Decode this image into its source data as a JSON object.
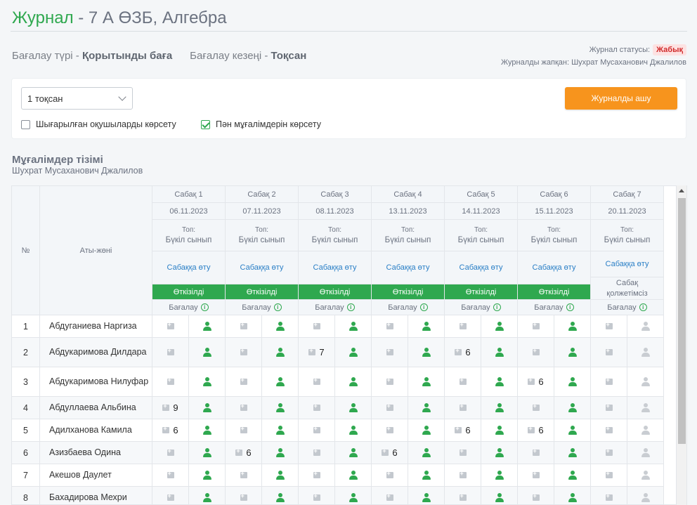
{
  "header": {
    "title_accent": "Журнал",
    "title_rest": " - 7 А ӨЗБ, Алгебра"
  },
  "assessment": {
    "type_label": "Бағалау түрі - ",
    "type_value": "Қорытынды баға",
    "period_label": "Бағалау кезеңі - ",
    "period_value": "Тоқсан"
  },
  "status": {
    "label": "Журнал статусы:",
    "value": "Жабық",
    "closed_by": "Журналды жапқан: Шухрат Мусаханович Джалилов"
  },
  "filters": {
    "period_select": "1 тоқсан",
    "open_button": "Журналды ашу",
    "show_graduated": {
      "label": "Шығарылған оқушыларды көрсету",
      "checked": false
    },
    "show_teachers": {
      "label": "Пән мұғалімдерін көрсету",
      "checked": true
    }
  },
  "teachers": {
    "title": "Мұғалімдер тізімі",
    "name": "Шухрат Мусаханович Джалилов"
  },
  "grid": {
    "col_num": "№",
    "col_name": "Аты-жөні",
    "type_label": "Топ:",
    "grade_label": "Бағалау",
    "lessons": [
      {
        "name": "Сабақ 1",
        "date": "06.11.2023",
        "group": "Бүкіл сынып",
        "link": "Сабаққа өту",
        "status": "Өткізілді",
        "done": true
      },
      {
        "name": "Сабақ 2",
        "date": "07.11.2023",
        "group": "Бүкіл сынып",
        "link": "Сабаққа өту",
        "status": "Өткізілді",
        "done": true
      },
      {
        "name": "Сабақ 3",
        "date": "08.11.2023",
        "group": "Бүкіл сынып",
        "link": "Сабаққа өту",
        "status": "Өткізілді",
        "done": true
      },
      {
        "name": "Сабақ 4",
        "date": "13.11.2023",
        "group": "Бүкіл сынып",
        "link": "Сабаққа өту",
        "status": "Өткізілді",
        "done": true
      },
      {
        "name": "Сабақ 5",
        "date": "14.11.2023",
        "group": "Бүкіл сынып",
        "link": "Сабаққа өту",
        "status": "Өткізілді",
        "done": true
      },
      {
        "name": "Сабақ 6",
        "date": "15.11.2023",
        "group": "Бүкіл сынып",
        "link": "Сабаққа өту",
        "status": "Өткізілді",
        "done": true
      },
      {
        "name": "Сабақ 7",
        "date": "20.11.2023",
        "group": "Бүкіл сынып",
        "link": "Сабаққа өту",
        "status": "Сабақ қолжетімсіз",
        "done": false
      }
    ],
    "students": [
      {
        "num": "1",
        "name": "Абдуганиева Наргиза",
        "marks": [
          "",
          "",
          "",
          "",
          "",
          "",
          ""
        ]
      },
      {
        "num": "2",
        "name": "Абдукаримова Дилдара",
        "marks": [
          "",
          "",
          "7",
          "",
          "6",
          "",
          ""
        ]
      },
      {
        "num": "3",
        "name": "Абдукаримова Нилуфар",
        "marks": [
          "",
          "",
          "",
          "",
          "",
          "6",
          ""
        ]
      },
      {
        "num": "4",
        "name": "Абдуллаева Альбина",
        "marks": [
          "9",
          "",
          "",
          "",
          "",
          "",
          ""
        ]
      },
      {
        "num": "5",
        "name": "Адилханова Камила",
        "marks": [
          "6",
          "",
          "",
          "",
          "6",
          "6",
          ""
        ]
      },
      {
        "num": "6",
        "name": "Азизбаева Одина",
        "marks": [
          "",
          "6",
          "",
          "6",
          "",
          "",
          ""
        ]
      },
      {
        "num": "7",
        "name": "Акешов Даулет",
        "marks": [
          "",
          "",
          "",
          "",
          "",
          "",
          ""
        ]
      },
      {
        "num": "8",
        "name": "Бахадирова Мехри",
        "marks": [
          "",
          "",
          "",
          "",
          "",
          "",
          ""
        ]
      }
    ]
  },
  "colors": {
    "accent": "#2fa84f",
    "button": "#f7941d",
    "link": "#2a7fc6",
    "closed_badge": "#d12c2c"
  },
  "icons": {
    "comment": "comment-plus-icon",
    "attendance": "person-icon",
    "info": "info-icon"
  }
}
